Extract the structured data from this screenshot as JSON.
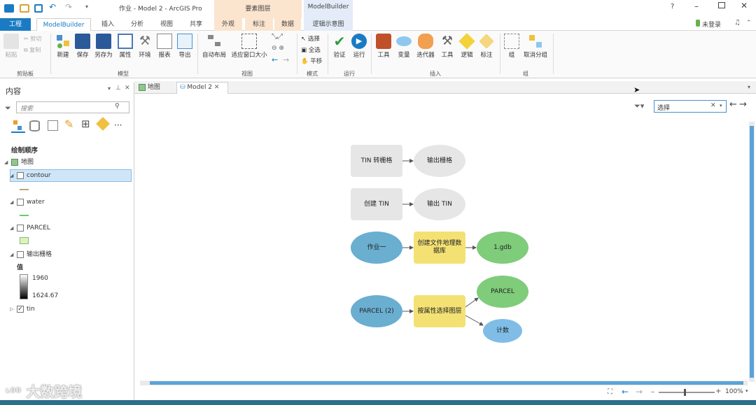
{
  "window": {
    "title": "作业 - Model 2 - ArcGIS Pro",
    "context_tab_1": "要素图层",
    "context_tab_2": "ModelBuilder",
    "help": "?",
    "login": "未登录"
  },
  "ribbon_tabs": [
    "工程",
    "ModelBuilder",
    "插入",
    "分析",
    "视图",
    "共享",
    "外观",
    "标注",
    "数据",
    "逻辑示意图"
  ],
  "ribbon": {
    "clipboard": {
      "paste": "粘贴",
      "cut": "剪切",
      "copy": "复制",
      "group": "剪贴板"
    },
    "model": {
      "new": "新建",
      "save": "保存",
      "save_as": "另存为",
      "properties": "属性",
      "environments": "环境",
      "report": "报表",
      "export": "导出",
      "group": "模型"
    },
    "view": {
      "auto_layout": "自动布局",
      "fit_to_window": "适应窗口大小",
      "group": "视图"
    },
    "mode": {
      "select": "选择",
      "select_all": "全选",
      "pan": "平移",
      "group": "模式"
    },
    "run": {
      "validate": "验证",
      "run": "运行",
      "group": "运行"
    },
    "insert": {
      "tools": "工具",
      "variable": "变量",
      "iterators": "迭代器",
      "utilities": "工具",
      "logical": "逻辑",
      "label": "标注",
      "group": "插入"
    },
    "group_sec": {
      "group": "组",
      "ungroup": "取消分组",
      "group_label": "组"
    }
  },
  "contents": {
    "title": "内容",
    "search_placeholder": "搜索",
    "drawing_order": "绘制顺序",
    "map_name": "地图",
    "layers": [
      {
        "name": "contour",
        "checked": false,
        "symbol": "line",
        "color": "#b8a878"
      },
      {
        "name": "water",
        "checked": false,
        "symbol": "line",
        "color": "#6cc86c"
      },
      {
        "name": "PARCEL",
        "checked": false,
        "symbol": "fill",
        "color": "#d8f5c0"
      },
      {
        "name": "输出栅格",
        "checked": false,
        "symbol": "ramp"
      },
      {
        "name": "tin",
        "checked": true
      }
    ],
    "value_label": "值",
    "ramp_high": "1960",
    "ramp_low": "1624.67"
  },
  "doc_tabs": [
    {
      "label": "地图"
    },
    {
      "label": "Model 2",
      "active": true
    }
  ],
  "canvas": {
    "search_value": "选择",
    "zoom": "100%",
    "nodes": {
      "tin_to_raster": "TIN 转栅格",
      "output_raster": "输出栅格",
      "create_tin": "创建 TIN",
      "output_tin": "输出 TIN",
      "zuoye": "作业一",
      "create_gdb": "创建文件地理数据库",
      "gdb": "1.gdb",
      "parcel2": "PARCEL (2)",
      "select_by_attr": "按属性选择图层",
      "parcel_out": "PARCEL",
      "count": "计数"
    }
  },
  "watermark": "大数跨境",
  "colors": {
    "accent": "#1a7bc4",
    "tool_yellow": "#f3e174",
    "data_blue": "#6aaed0",
    "output_green": "#7fcc7a",
    "count_blue": "#7fbde6",
    "disabled_gray": "#e6e6e6"
  }
}
